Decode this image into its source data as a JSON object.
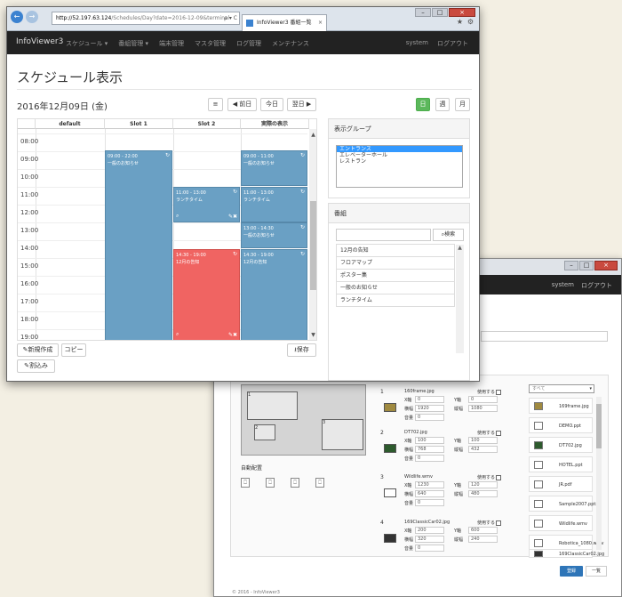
{
  "back_window": {
    "nav": {
      "system": "system",
      "logout": "ログアウト"
    },
    "auto_layout_label": "自動配置",
    "preview_regions": [
      "1",
      "2",
      "3"
    ],
    "items": [
      {
        "num": "1",
        "file": "160frame.jpg",
        "use": "使用する",
        "x_label": "X軸",
        "x": "0",
        "y_label": "Y軸",
        "y": "0",
        "w_label": "横幅",
        "w": "1920",
        "h_label": "縦幅",
        "h": "1080",
        "vol_label": "音量",
        "vol": "0"
      },
      {
        "num": "2",
        "file": "DT702.jpg",
        "use": "使用する",
        "x_label": "X軸",
        "x": "100",
        "y_label": "Y軸",
        "y": "100",
        "w_label": "横幅",
        "w": "768",
        "h_label": "縦幅",
        "h": "432",
        "vol_label": "音量",
        "vol": "0"
      },
      {
        "num": "3",
        "file": "Wildlife.wmv",
        "use": "使用する",
        "x_label": "X軸",
        "x": "1230",
        "y_label": "Y軸",
        "y": "120",
        "w_label": "横幅",
        "w": "640",
        "h_label": "縦幅",
        "h": "480",
        "vol_label": "音量",
        "vol": "0"
      },
      {
        "num": "4",
        "file": "169ClassicCar02.jpg",
        "use": "使用する",
        "x_label": "X軸",
        "x": "200",
        "y_label": "Y軸",
        "y": "600",
        "w_label": "横幅",
        "w": "320",
        "h_label": "縦幅",
        "h": "240",
        "vol_label": "音量",
        "vol": "0"
      }
    ],
    "file_filter": "すべて",
    "files": [
      "169frame.jpg",
      "DEMO.ppt",
      "DT702.jpg",
      "HOTEL.ppt",
      "JR.pdf",
      "Sample2007.pptx",
      "Wildlife.wmv",
      "Robotica_1080.wmv",
      "169ClassicCar02.jpg"
    ],
    "save_button": "登録",
    "list_button": "一覧",
    "footer": "© 2016 - InfoViewer3"
  },
  "browser": {
    "address_host": "http://52.197.63.124",
    "address_path": "/Schedules/Day?date=2016-12-09&terminal",
    "address_controls": "ρ ▾ C",
    "tab_title": "InfoViewer3 番組一覧",
    "tab_close": "×",
    "star": "★",
    "gear": "⚙",
    "back": "←",
    "forward": "→",
    "minimize": "–",
    "maximize": "□",
    "close": "×"
  },
  "nav": {
    "brand": "InfoViewer3",
    "items": [
      "スケジュール ▾",
      "番組管理 ▾",
      "端末管理",
      "マスタ管理",
      "ログ管理",
      "メンテナンス"
    ],
    "system": "system",
    "logout": "ログアウト"
  },
  "page": {
    "title": "スケジュール表示",
    "date": "2016年12月09日 (金)",
    "toolbar": {
      "menu": "≡",
      "prev": "◀ 前日",
      "today": "今日",
      "next": "翌日 ▶",
      "day": "日",
      "week": "週",
      "month": "月"
    }
  },
  "schedule": {
    "columns": [
      "default",
      "Slot 1",
      "Slot 2",
      "実際の表示"
    ],
    "times": [
      "08:00",
      "09:00",
      "10:00",
      "11:00",
      "12:00",
      "13:00",
      "14:00",
      "15:00",
      "16:00",
      "17:00",
      "18:00",
      "19:00"
    ],
    "events": {
      "e1": {
        "time": "09:00 - 22:00",
        "title": "一般のお知らせ"
      },
      "e2": {
        "time": "11:00 - 13:00",
        "title": "ランチタイム"
      },
      "e3": {
        "time": "14:30 - 19:00",
        "title": "12月の告知"
      },
      "e4": {
        "time": "09:00 - 11:00",
        "title": "一般のお知らせ"
      },
      "e5": {
        "time": "11:00 - 13:00",
        "title": "ランチタイム"
      },
      "e6": {
        "time": "13:00 - 14:30",
        "title": "一般のお知らせ"
      },
      "e7": {
        "time": "14:30 - 19:00",
        "title": "12月の告知"
      }
    },
    "buttons": {
      "new": "新規作成",
      "copy": "コピー",
      "split": "割込み",
      "save": "保存"
    }
  },
  "groups": {
    "heading": "表示グループ",
    "items": [
      "エントランス",
      "エレベーターホール",
      "レストラン"
    ]
  },
  "programs": {
    "heading": "番組",
    "search_button": "検索",
    "items": [
      "12月の告知",
      "フロアマップ",
      "ポスター集",
      "一般のお知らせ",
      "ランチタイム"
    ]
  }
}
